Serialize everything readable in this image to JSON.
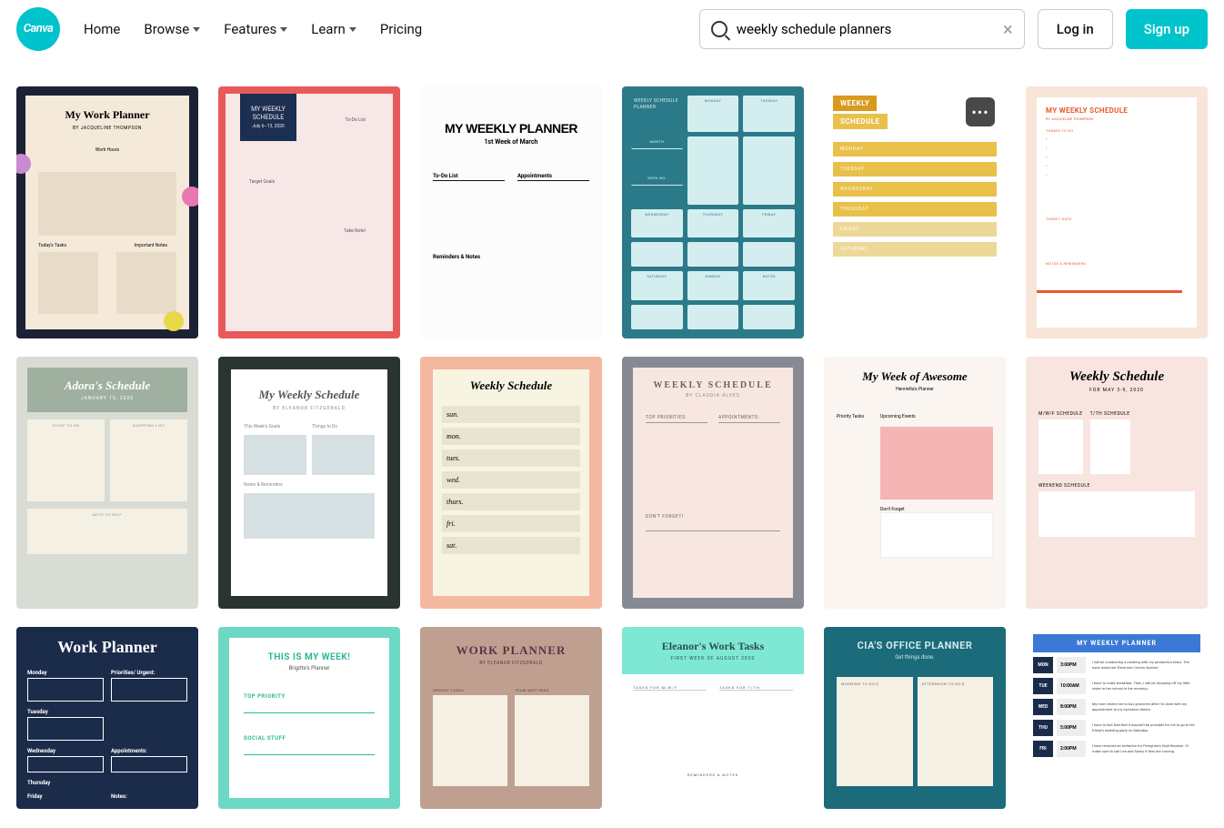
{
  "header": {
    "logo_text": "Canva",
    "nav": [
      "Home",
      "Browse",
      "Features",
      "Learn",
      "Pricing"
    ],
    "search_value": "weekly schedule planners",
    "login": "Log in",
    "signup": "Sign up"
  },
  "r1c1": {
    "title": "My Work Planner",
    "by": "BY JACQUELINE THOMPSON",
    "s1": "Work Hours",
    "s2": "Today's Tasks",
    "s3": "Important Notes"
  },
  "r1c2": {
    "title": "MY WEEKLY SCHEDULE",
    "date": "July 6–13, 2020",
    "s1": "To-Do List",
    "s2": "Target Goals",
    "s3": "Take Note!"
  },
  "r1c3": {
    "title": "MY WEEKLY PLANNER",
    "sub": "1st Week of March",
    "s1": "To-Do List",
    "s2": "Appointments",
    "s3": "Reminders & Notes"
  },
  "r1c4": {
    "title": "WEEKLY SCHEDULE PLANNER",
    "labels": [
      "MONDAY",
      "TUESDAY",
      "MONTH",
      "WEEK NO.",
      "WEDNESDAY",
      "THURSDAY",
      "FRIDAY",
      "SATURDAY",
      "SUNDAY",
      "NOTES"
    ]
  },
  "r1c5": {
    "t1": "WEEKLY",
    "t2": "SCHEDULE",
    "days": [
      "MONDAY",
      "TUESDAY",
      "WEDNESDAY",
      "THURSDAY",
      "FRIDAY",
      "SATURDAY"
    ]
  },
  "r1c6": {
    "title": "MY WEEKLY SCHEDULE",
    "by": "BY JACQUELINE THOMPSON",
    "s1": "THINGS TO DO",
    "s2": "TARGET DATE",
    "s3": "NOTES & REMINDERS"
  },
  "r2c1": {
    "title": "Adora's Schedule",
    "date": "JANUARY 15, 2020",
    "s1": "STUFF TO DO",
    "s2": "SHOPPING LIST",
    "s3": "NOTE TO SELF"
  },
  "r2c2": {
    "title": "My Weekly Schedule",
    "by": "BY ELEANOR FITZGERALD",
    "s1": "This Week's Goals",
    "s2": "Things to Do",
    "s3": "Notes & Reminders"
  },
  "r2c3": {
    "title": "Weekly Schedule",
    "days": [
      "sun.",
      "mon.",
      "tues.",
      "wed.",
      "thurs.",
      "fri.",
      "sat."
    ]
  },
  "r2c4": {
    "title": "WEEKLY SCHEDULE",
    "by": "BY CLAUDIA ALVES",
    "s1": "TOP PRIORITIES:",
    "s2": "APPOINTMENTS:",
    "s3": "DON'T FORGET!"
  },
  "r2c5": {
    "title": "My Week of Awesome",
    "by": "Henrietta's Planner",
    "s1": "Priority Tasks",
    "s2": "Upcoming Events",
    "s3": "Don't Forget"
  },
  "r2c6": {
    "title": "Weekly Schedule",
    "date": "FOR MAY 3-9, 2020",
    "s1": "M/W/F SCHEDULE",
    "s2": "T/TH SCHEDULE",
    "s3": "WEEKEND SCHEDULE"
  },
  "r3c1": {
    "title": "Work Planner",
    "days": [
      "Monday",
      "Tuesday",
      "Wednesday",
      "Thursday",
      "Friday"
    ],
    "s1": "Priorities/ Urgent:",
    "s2": "Appointments:",
    "s3": "Notes:"
  },
  "r3c2": {
    "title": "THIS IS MY WEEK!",
    "by": "Brigitte's Planner",
    "s1": "TOP PRIORITY",
    "s2": "SOCIAL STUFF"
  },
  "r3c3": {
    "title": "WORK PLANNER",
    "by": "BY ELEANOR FITZGERALD",
    "s1": "URGENT TASKS",
    "s2": "TEAM MEETINGS"
  },
  "r3c4": {
    "title": "Eleanor's Work Tasks",
    "date": "FIRST WEEK OF AUGUST 2020",
    "s1": "TASKS FOR M/W/F",
    "s2": "TASKS FOR T/TH",
    "s3": "REMINDERS & NOTES"
  },
  "r3c5": {
    "title": "CIA'S OFFICE PLANNER",
    "sub": "Get things done.",
    "s1": "MORNING TO-DO'S",
    "s2": "AFTERNOON TO-DO'S"
  },
  "r3c6": {
    "title": "MY WEEKLY PLANNER",
    "rows": [
      {
        "d": "MON",
        "t": "3:00PM",
        "txt": "I will be conducting a meeting with my production team. The topic would be 'Electronic Device System'."
      },
      {
        "d": "TUE",
        "t": "10:00AM",
        "txt": "I have to make breakfast. Then, I will be dropping off my little sister to her school in the morning."
      },
      {
        "d": "WED",
        "t": "8:00PM",
        "txt": "My mom texted me to buy groceries after I'm done with my appointment to my exclusive clients."
      },
      {
        "d": "THU",
        "t": "5:00PM",
        "txt": "I have to text Dad that it wouldn't be possible for me to go to his friend's wedding party on Saturday."
      },
      {
        "d": "FRI",
        "t": "2:00PM",
        "txt": "I have received an invitation for Peregrine's High Reunion. I'll make sure to call Lea and Sunny if they are coming."
      }
    ]
  }
}
